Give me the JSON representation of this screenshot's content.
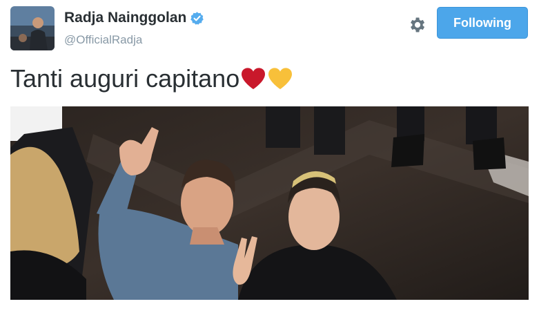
{
  "header": {
    "display_name": "Radja Nainggolan",
    "handle": "@OfficialRadja",
    "follow_button_label": "Following",
    "verified": true
  },
  "tweet": {
    "text": "Tanti auguri capitano",
    "emoji": [
      "red-heart",
      "yellow-heart"
    ]
  },
  "icons": [
    "avatar",
    "verified-badge-icon",
    "gear-icon",
    "red-heart-icon",
    "yellow-heart-icon"
  ],
  "colors": {
    "follow_button_bg": "#4ca6ea",
    "verified_blue": "#55acee",
    "name_text": "#292f33",
    "handle_text": "#8899a6",
    "heart_red": "#c9182b",
    "heart_yellow": "#f8c03a"
  }
}
